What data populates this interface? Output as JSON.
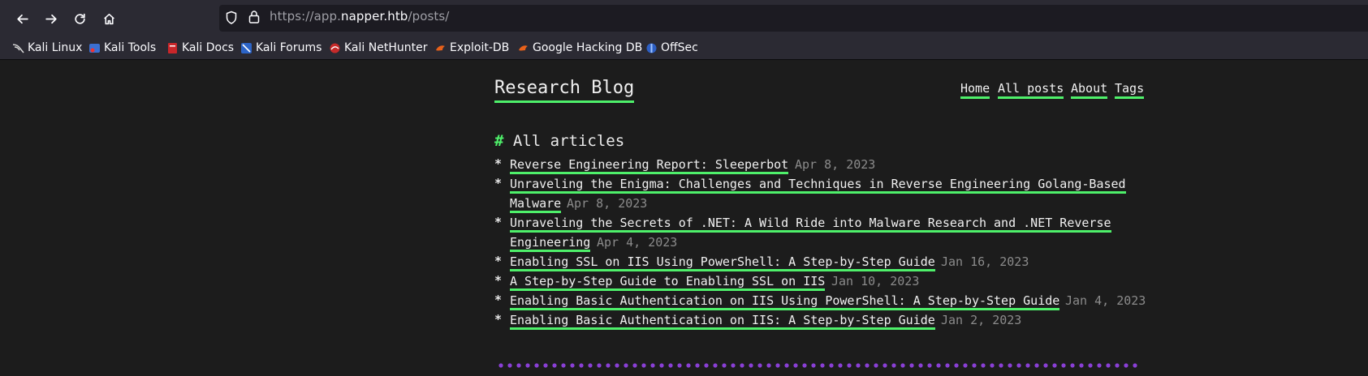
{
  "browser": {
    "url_prefix": "https://app.",
    "url_host": "napper.htb",
    "url_path": "/posts/",
    "bookmarks": [
      {
        "label": "Kali Linux",
        "icon": "kali-dragon-icon"
      },
      {
        "label": "Kali Tools",
        "icon": "kali-tools-icon"
      },
      {
        "label": "Kali Docs",
        "icon": "kali-docs-icon"
      },
      {
        "label": "Kali Forums",
        "icon": "kali-forums-icon"
      },
      {
        "label": "Kali NetHunter",
        "icon": "kali-nethunter-icon"
      },
      {
        "label": "Exploit-DB",
        "icon": "exploit-db-icon"
      },
      {
        "label": "Google Hacking DB",
        "icon": "ghdb-icon"
      },
      {
        "label": "OffSec",
        "icon": "offsec-icon"
      }
    ]
  },
  "site": {
    "title": "Research Blog",
    "nav": [
      "Home",
      "All posts",
      "About",
      "Tags"
    ],
    "section_hash": "#",
    "section_title": "All articles",
    "bullet": "*",
    "posts": [
      {
        "title": "Reverse Engineering Report: Sleeperbot",
        "date": "Apr 8, 2023"
      },
      {
        "title_line1": "Unraveling the Enigma: Challenges and Techniques in Reverse Engineering Golang-Based",
        "title_line2": "Malware",
        "date": "Apr 8, 2023"
      },
      {
        "title_line1": "Unraveling the Secrets of .NET: A Wild Ride into Malware Research and .NET Reverse",
        "title_line2": "Engineering",
        "date": "Apr 4, 2023"
      },
      {
        "title": "Enabling SSL on IIS Using PowerShell: A Step-by-Step Guide",
        "date": "Jan 16, 2023"
      },
      {
        "title": "A Step-by-Step Guide to Enabling SSL on IIS",
        "date": "Jan 10, 2023"
      },
      {
        "title": "Enabling Basic Authentication on IIS Using PowerShell: A Step-by-Step Guide",
        "date": "Jan 4, 2023"
      },
      {
        "title": "Enabling Basic Authentication on IIS: A Step-by-Step Guide",
        "date": "Jan 2, 2023"
      }
    ]
  },
  "colors": {
    "accent": "#4ef06a",
    "divider_dots": "#8a3fd6",
    "background": "#1c1c1c"
  }
}
